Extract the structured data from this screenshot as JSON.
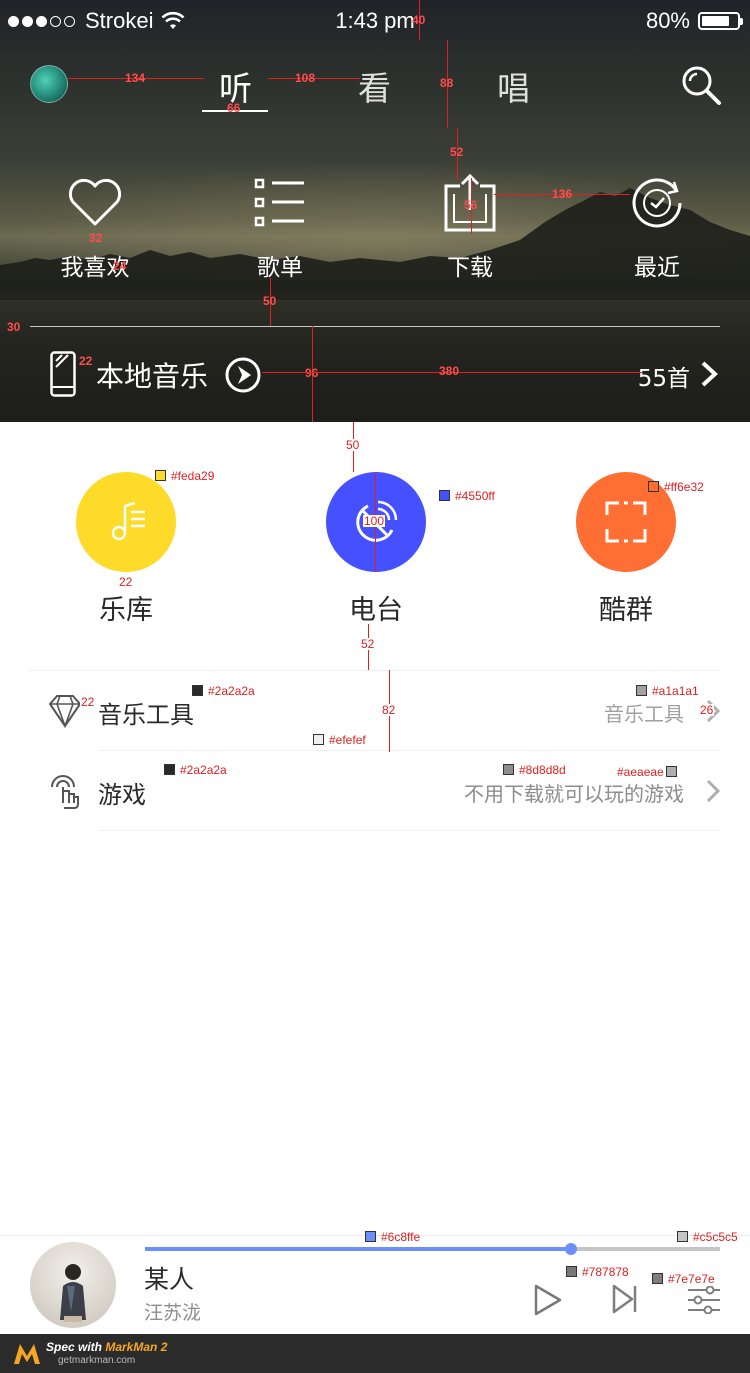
{
  "status_bar": {
    "carrier": "Strokei",
    "time": "1:43 pm",
    "battery": "80%",
    "battery_level": 0.8
  },
  "nav": {
    "tabs": [
      {
        "label": "听",
        "active": true
      },
      {
        "label": "看",
        "active": false
      },
      {
        "label": "唱",
        "active": false
      }
    ],
    "search_icon": "search-icon"
  },
  "quick_actions": [
    {
      "label": "我喜欢",
      "icon": "heart-icon"
    },
    {
      "label": "歌单",
      "icon": "playlist-icon"
    },
    {
      "label": "下载",
      "icon": "download-icon"
    },
    {
      "label": "最近",
      "icon": "clock-icon"
    }
  ],
  "local_music": {
    "title": "本地音乐",
    "count": "55首"
  },
  "features": [
    {
      "label": "乐库",
      "color": "#feda29",
      "icon": "music-note-icon"
    },
    {
      "label": "电台",
      "color": "#4550ff",
      "icon": "radio-icon"
    },
    {
      "label": "酷群",
      "color": "#ff6e32",
      "icon": "group-frame-icon"
    }
  ],
  "list": [
    {
      "title": "音乐工具",
      "subtitle": "音乐工具",
      "subtitle_color": "#a1a1a1",
      "icon": "diamond-icon"
    },
    {
      "title": "游戏",
      "subtitle": "不用下载就可以玩的游戏",
      "subtitle_color": "#8d8d8d",
      "icon": "game-touch-icon"
    }
  ],
  "player": {
    "song": "某人",
    "artist": "汪苏泷",
    "progress": 0.74,
    "progress_color": "#6c8ffe",
    "track_color": "#c5c5c5"
  },
  "footer": {
    "prefix": "Spec with ",
    "brand": "MarkMan 2",
    "url": "getmarkman.com"
  },
  "annotations": {
    "colors": {
      "yellow": "#feda29",
      "blue": "#4550ff",
      "orange": "#ff6e32",
      "title1": "#2a2a2a",
      "sub1": "#a1a1a1",
      "divider": "#efefef",
      "title2": "#2a2a2a",
      "sub2": "#8d8d8d",
      "chevron": "#aeaeae",
      "progress": "#6c8ffe",
      "track": "#c5c5c5",
      "play": "#787878",
      "next": "#7e7e7e"
    },
    "measures": {
      "status_h": "40",
      "avatar_gap": "134",
      "tab_gap": "108",
      "tab_w": "66",
      "nav_h": "88",
      "nav_gap": "52",
      "heart": "32",
      "heart_w": "24",
      "dl_icon": "56",
      "icon_gap": "136",
      "label_gap": "50",
      "margin": "30",
      "phone_gap": "22",
      "row_h": "96",
      "count_gap": "380",
      "circle_gap": "50",
      "circle_d": "100",
      "circle_lbl": "22",
      "list_gap": "52",
      "list_h": "82",
      "list_icon": "22",
      "chev_w": "26"
    }
  }
}
